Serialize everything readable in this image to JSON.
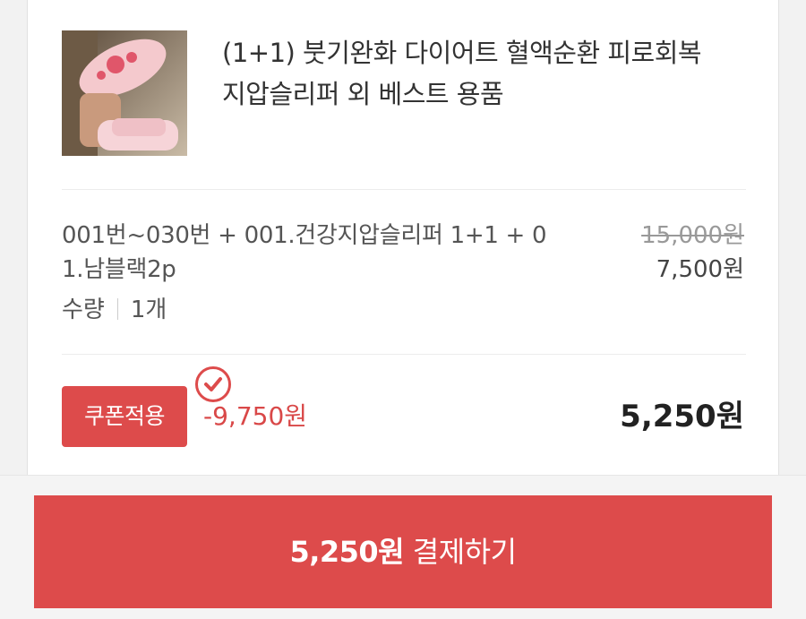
{
  "product": {
    "title_line1": "(1+1) 붓기완화 다이어트 혈액순환 피로회복",
    "title_line2": "지압슬리퍼 외 베스트 용품",
    "image_icon": "pink-slipper-photo"
  },
  "option": {
    "line1": "001번~030번 + 001.건강지압슬리퍼 1+1 + 0",
    "line2": "1.남블랙2p",
    "qty_label": "수량",
    "qty_value": "1개",
    "original_price": "15,000원",
    "sale_price": "7,500원"
  },
  "coupon": {
    "button_label": "쿠폰적용",
    "badge_icon": "check-circle-icon",
    "discount": "-9,750원",
    "final_price": "5,250원"
  },
  "checkout": {
    "amount": "5,250원",
    "action": "결제하기"
  },
  "colors": {
    "accent": "#dd4b4b",
    "discount_text": "#d94848"
  }
}
